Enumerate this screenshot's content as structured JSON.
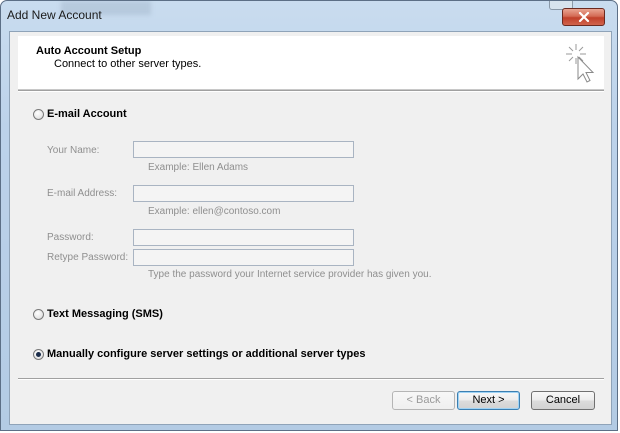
{
  "window": {
    "title": "Add New Account",
    "close_icon": "close-x-icon"
  },
  "header": {
    "title": "Auto Account Setup",
    "subtitle": "Connect to other server types.",
    "icon": "wizard-sparkle-cursor-icon"
  },
  "options": {
    "email": {
      "label": "E-mail Account",
      "selected": false
    },
    "sms": {
      "label": "Text Messaging (SMS)",
      "selected": false
    },
    "manual": {
      "label": "Manually configure server settings or additional server types",
      "selected": true
    }
  },
  "form": {
    "name": {
      "label": "Your Name:",
      "value": "",
      "hint": "Example: Ellen Adams"
    },
    "email": {
      "label": "E-mail Address:",
      "value": "",
      "hint": "Example: ellen@contoso.com"
    },
    "password": {
      "label": "Password:",
      "value": ""
    },
    "retype": {
      "label": "Retype Password:",
      "value": "",
      "hint": "Type the password your Internet service provider has given you."
    }
  },
  "buttons": {
    "back": "< Back",
    "next": "Next >",
    "cancel": "Cancel"
  }
}
